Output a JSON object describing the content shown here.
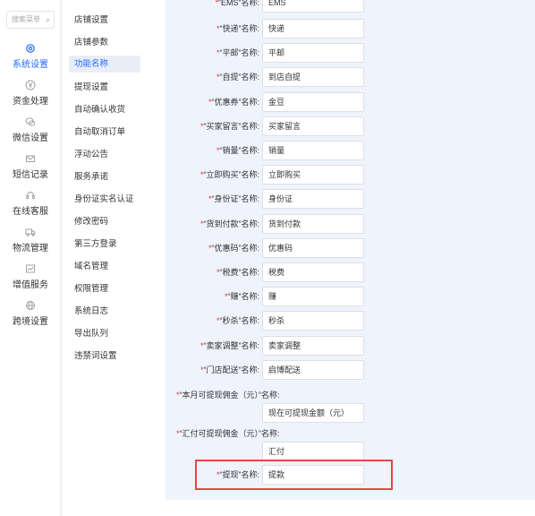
{
  "rail": {
    "search_placeholder": "搜索菜单",
    "items": [
      {
        "label": "系统设置",
        "icon": "gear-icon"
      },
      {
        "label": "资金处理",
        "icon": "yen-icon"
      },
      {
        "label": "微信设置",
        "icon": "wechat-icon"
      },
      {
        "label": "短信记录",
        "icon": "mail-icon"
      },
      {
        "label": "在线客服",
        "icon": "headset-icon"
      },
      {
        "label": "物流管理",
        "icon": "truck-icon"
      },
      {
        "label": "增值服务",
        "icon": "chart-icon"
      },
      {
        "label": "跨境设置",
        "icon": "globe-icon"
      }
    ]
  },
  "submenu": {
    "items": [
      "店铺设置",
      "店铺参数",
      "功能名称",
      "提现设置",
      "自动确认收货",
      "自动取消订单",
      "浮动公告",
      "服务承诺",
      "身份证实名认证",
      "修改密码",
      "第三方登录",
      "域名管理",
      "权限管理",
      "系统日志",
      "导出队列",
      "违禁词设置"
    ],
    "active": "功能名称"
  },
  "form": {
    "required_mark": "*",
    "top_row": {
      "label": "“EMS”名称:",
      "value": "EMS"
    },
    "fields": [
      {
        "label": "“快递”名称:",
        "value": "快递"
      },
      {
        "label": "“平邮”名称:",
        "value": "平邮"
      },
      {
        "label": "“自提”名称:",
        "value": "到店自提"
      },
      {
        "label": "“优惠券”名称:",
        "value": "金豆"
      },
      {
        "label": "“买家留言”名称:",
        "value": "买家留言"
      },
      {
        "label": "“销量”名称:",
        "value": "销量"
      },
      {
        "label": "“立即购买”名称:",
        "value": "立即购买"
      },
      {
        "label": "“身份证”名称:",
        "value": "身份证"
      },
      {
        "label": "“货到付款”名称:",
        "value": "货到付款"
      },
      {
        "label": "“优惠码”名称:",
        "value": "优惠码"
      },
      {
        "label": "“税费”名称:",
        "value": "税费"
      },
      {
        "label": "“赚”名称:",
        "value": "赚"
      },
      {
        "label": "“秒杀”名称:",
        "value": "秒杀"
      },
      {
        "label": "“卖家调整”名称:",
        "value": "卖家调整"
      },
      {
        "label": "“门店配送”名称:",
        "value": "启博配送"
      }
    ],
    "long_fields": [
      {
        "label": "“本月可提现佣金（元）”名称:",
        "value": "现在可提现金额（元）"
      },
      {
        "label": "“汇付可提现佣金（元）”名称:",
        "value": "汇付"
      }
    ],
    "withdraw": {
      "label": "“提现”名称:",
      "value": "提款"
    }
  },
  "colors": {
    "accent": "#1e6bff",
    "required": "#e23636",
    "highlight": "#e64646"
  }
}
